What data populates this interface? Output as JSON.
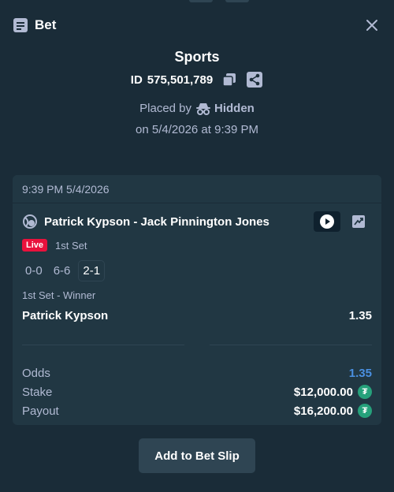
{
  "header": {
    "title": "Bet",
    "icons": [
      "bet-slip-icon",
      "close-icon"
    ]
  },
  "summary": {
    "sport": "Sports",
    "id_prefix": "ID",
    "id_value": "575,501,789",
    "placed_by_label": "Placed by",
    "placed_by_user": "Hidden",
    "placed_on": "on 5/4/2026 at 9:39 PM",
    "icons": [
      "copy-icon",
      "share-icon",
      "incognito-icon"
    ]
  },
  "card": {
    "timestamp": "9:39 PM 5/4/2026",
    "event": "Patrick Kypson - Jack Pinnington Jones",
    "live_label": "Live",
    "period": "1st Set",
    "scores": [
      "0-0",
      "6-6",
      "2-1"
    ],
    "market": "1st Set - Winner",
    "selection": "Patrick Kypson",
    "selection_odds": "1.35",
    "odds_label": "Odds",
    "odds_value": "1.35",
    "stake_label": "Stake",
    "stake_value": "$12,000.00",
    "payout_label": "Payout",
    "payout_value": "$16,200.00",
    "icons": [
      "tennis-ball-icon",
      "play-icon",
      "stats-icon",
      "tether-icon"
    ]
  },
  "actions": {
    "add_to_slip": "Add to Bet Slip"
  },
  "colors": {
    "background": "#1a2c38",
    "card": "#213743",
    "live": "#e9113c",
    "odds": "#4a90e2",
    "tether": "#26a17b",
    "button": "#2f4553"
  }
}
